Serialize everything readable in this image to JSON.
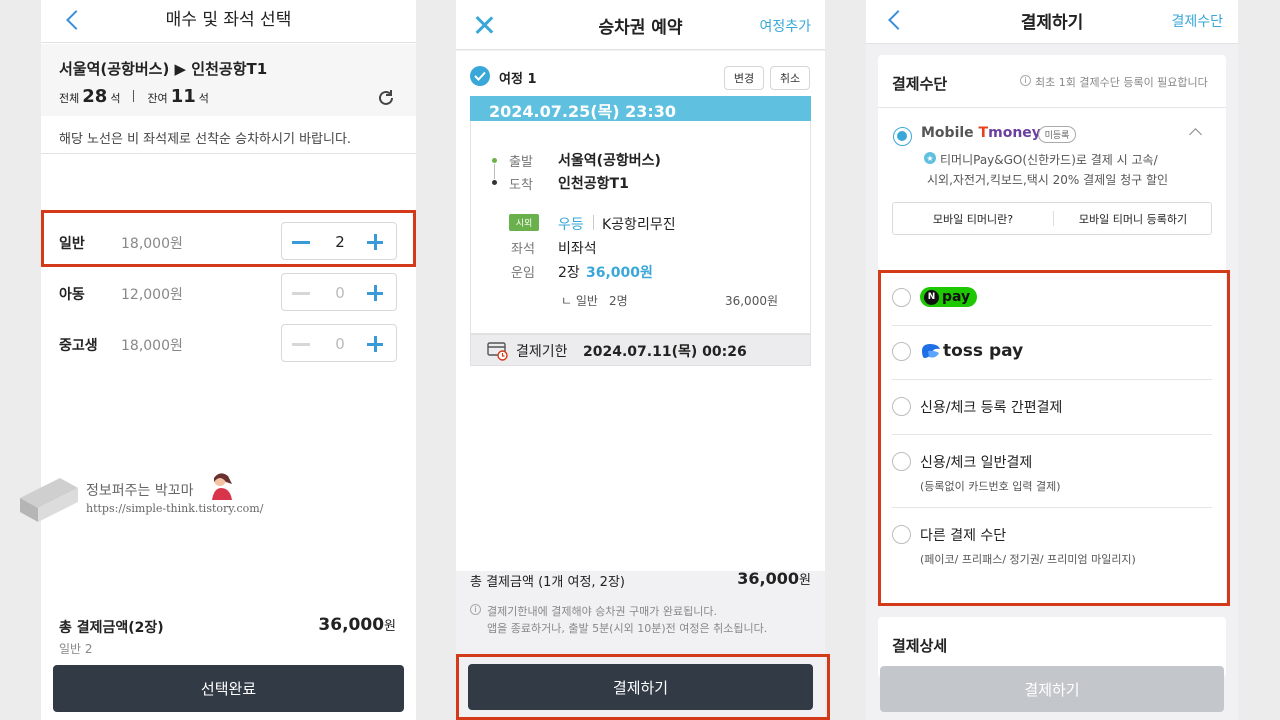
{
  "panel1": {
    "title": "매수 및 좌석 선택",
    "route": "서울역(공항버스) ▶ 인천공항T1",
    "total_label": "전체",
    "total_count": "28",
    "remain_label": "잔여",
    "remain_count": "11",
    "seat_unit": "석",
    "notice": "해당 노선은 비 좌석제로 선착순 승차하시기 바랍니다.",
    "fares": [
      {
        "label": "일반",
        "price": "18,000원",
        "count": "2"
      },
      {
        "label": "아동",
        "price": "12,000원",
        "count": "0"
      },
      {
        "label": "중고생",
        "price": "18,000원",
        "count": "0"
      }
    ],
    "total_amount_label": "총 결제금액(2장)",
    "total_amount": "36,000",
    "won": "원",
    "total_detail": "일반 2",
    "submit": "선택완료"
  },
  "watermark": {
    "title": "정보퍼주는 박꼬마",
    "url": "https://simple-think.tistory.com/"
  },
  "panel2": {
    "title": "승차권 예약",
    "add_trip": "여정추가",
    "trip_label": "여정 1",
    "edit": "변경",
    "cancel": "취소",
    "datetime": "2024.07.25(목) 23:30",
    "depart_label": "출발",
    "depart": "서울역(공항버스)",
    "arrive_label": "도착",
    "arrive": "인천공항T1",
    "region_badge": "시외",
    "grade": "우등",
    "company": "K공항리무진",
    "seat_label": "좌석",
    "seat_value": "비좌석",
    "fare_label": "운임",
    "fare_count": "2장",
    "fare_amount": "36,000원",
    "fare_sub_label": "ㄴ 일반",
    "fare_sub_count": "2명",
    "fare_sub_amount": "36,000원",
    "deadline_label": "결제기한",
    "deadline": "2024.07.11(목) 00:26",
    "total_label": "총 결제금액 (1개 여정, 2장)",
    "total_amount": "36,000",
    "won": "원",
    "info_line1": "결제기한내에 결제해야 승차권 구매가 완료됩니다.",
    "info_line2": "앱을 종료하거나, 출발 5분(시외 10분)전 여정은 취소됩니다.",
    "pay_button": "결제하기"
  },
  "panel3": {
    "title": "결제하기",
    "method_link": "결제수단",
    "section_title": "결제수단",
    "section_note": "최초 1회 결제수단 등록이 필요합니다",
    "tmoney_brand_a": "Mobile ",
    "tmoney_brand_b": "T",
    "tmoney_brand_c": "money",
    "tmoney_badge": "미등록",
    "tmoney_desc1": "티머니Pay&GO(신한카드)로 결제 시 고속/",
    "tmoney_desc2": "시외,자전거,킥보드,택시 20% 결제일 청구 할인",
    "tmoney_btn1": "모바일 티머니란?",
    "tmoney_btn2": "모바일 티머니 등록하기",
    "npay_n": "N",
    "npay_text": "pay",
    "toss_text": "toss pay",
    "opt_card_easy": "신용/체크 등록 간편결제",
    "opt_card_normal": "신용/체크 일반결제",
    "opt_card_normal_sub": "(등록없이 카드번호 입력 결제)",
    "opt_other": "다른 결제 수단",
    "opt_other_sub": "(페이코/ 프리패스/ 정기권/ 프리미엄 마일리지)",
    "detail_title": "결제상세",
    "pay_button": "결제하기"
  },
  "colors": {
    "accent": "#3aa7d9",
    "header_bar": "#5fc1df",
    "highlight": "#d23a1a",
    "dark_button": "#323a45",
    "disabled_button": "#c3c7cc"
  }
}
